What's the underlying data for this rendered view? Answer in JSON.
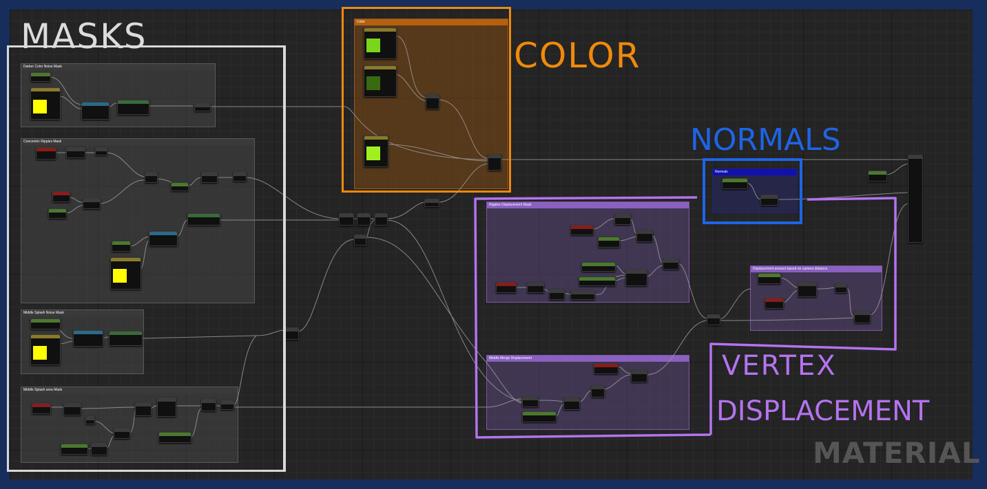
{
  "annotations": {
    "masks": "MASKS",
    "color": "COLOR",
    "normals": "NORMALS",
    "vertex_line1": "VERTEX",
    "vertex_line2": "DISPLACEMENT",
    "material": "MATERIAL"
  },
  "comments": {
    "darker_color_noise_mask": "Darker Color Noise Mask",
    "concentric_ripples_mask": "Concentric Ripples Mask",
    "middle_splash_noise_mask": "Middle Splash Noise Mask",
    "middle_splash_area_mask": "Middle Splash area Mask",
    "color": "Color",
    "normals": "Normals",
    "ripples_displacement_mask": "Ripples Displacement Mask",
    "displacement_camera_distance": "Displacement amount based on camera distance",
    "middle_merge_displacement": "Middle Merge Displacement"
  },
  "colors": {
    "masks_frame": "#d9d9d9",
    "color_frame": "#f08a0c",
    "normals_frame": "#1e64e6",
    "vertex_frame": "#b473f0",
    "swatch_yellow": "#ffff00",
    "swatch_green_bright": "#7ad61a",
    "swatch_green_dark": "#3a6a10",
    "swatch_green_lime": "#a0f020"
  }
}
